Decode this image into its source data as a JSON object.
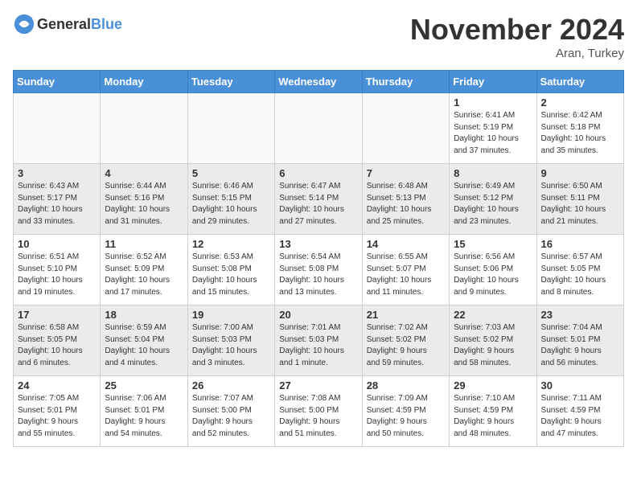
{
  "header": {
    "logo_general": "General",
    "logo_blue": "Blue",
    "month": "November 2024",
    "location": "Aran, Turkey"
  },
  "days_of_week": [
    "Sunday",
    "Monday",
    "Tuesday",
    "Wednesday",
    "Thursday",
    "Friday",
    "Saturday"
  ],
  "weeks": [
    [
      {
        "day": "",
        "info": ""
      },
      {
        "day": "",
        "info": ""
      },
      {
        "day": "",
        "info": ""
      },
      {
        "day": "",
        "info": ""
      },
      {
        "day": "",
        "info": ""
      },
      {
        "day": "1",
        "info": "Sunrise: 6:41 AM\nSunset: 5:19 PM\nDaylight: 10 hours\nand 37 minutes."
      },
      {
        "day": "2",
        "info": "Sunrise: 6:42 AM\nSunset: 5:18 PM\nDaylight: 10 hours\nand 35 minutes."
      }
    ],
    [
      {
        "day": "3",
        "info": "Sunrise: 6:43 AM\nSunset: 5:17 PM\nDaylight: 10 hours\nand 33 minutes."
      },
      {
        "day": "4",
        "info": "Sunrise: 6:44 AM\nSunset: 5:16 PM\nDaylight: 10 hours\nand 31 minutes."
      },
      {
        "day": "5",
        "info": "Sunrise: 6:46 AM\nSunset: 5:15 PM\nDaylight: 10 hours\nand 29 minutes."
      },
      {
        "day": "6",
        "info": "Sunrise: 6:47 AM\nSunset: 5:14 PM\nDaylight: 10 hours\nand 27 minutes."
      },
      {
        "day": "7",
        "info": "Sunrise: 6:48 AM\nSunset: 5:13 PM\nDaylight: 10 hours\nand 25 minutes."
      },
      {
        "day": "8",
        "info": "Sunrise: 6:49 AM\nSunset: 5:12 PM\nDaylight: 10 hours\nand 23 minutes."
      },
      {
        "day": "9",
        "info": "Sunrise: 6:50 AM\nSunset: 5:11 PM\nDaylight: 10 hours\nand 21 minutes."
      }
    ],
    [
      {
        "day": "10",
        "info": "Sunrise: 6:51 AM\nSunset: 5:10 PM\nDaylight: 10 hours\nand 19 minutes."
      },
      {
        "day": "11",
        "info": "Sunrise: 6:52 AM\nSunset: 5:09 PM\nDaylight: 10 hours\nand 17 minutes."
      },
      {
        "day": "12",
        "info": "Sunrise: 6:53 AM\nSunset: 5:08 PM\nDaylight: 10 hours\nand 15 minutes."
      },
      {
        "day": "13",
        "info": "Sunrise: 6:54 AM\nSunset: 5:08 PM\nDaylight: 10 hours\nand 13 minutes."
      },
      {
        "day": "14",
        "info": "Sunrise: 6:55 AM\nSunset: 5:07 PM\nDaylight: 10 hours\nand 11 minutes."
      },
      {
        "day": "15",
        "info": "Sunrise: 6:56 AM\nSunset: 5:06 PM\nDaylight: 10 hours\nand 9 minutes."
      },
      {
        "day": "16",
        "info": "Sunrise: 6:57 AM\nSunset: 5:05 PM\nDaylight: 10 hours\nand 8 minutes."
      }
    ],
    [
      {
        "day": "17",
        "info": "Sunrise: 6:58 AM\nSunset: 5:05 PM\nDaylight: 10 hours\nand 6 minutes."
      },
      {
        "day": "18",
        "info": "Sunrise: 6:59 AM\nSunset: 5:04 PM\nDaylight: 10 hours\nand 4 minutes."
      },
      {
        "day": "19",
        "info": "Sunrise: 7:00 AM\nSunset: 5:03 PM\nDaylight: 10 hours\nand 3 minutes."
      },
      {
        "day": "20",
        "info": "Sunrise: 7:01 AM\nSunset: 5:03 PM\nDaylight: 10 hours\nand 1 minute."
      },
      {
        "day": "21",
        "info": "Sunrise: 7:02 AM\nSunset: 5:02 PM\nDaylight: 9 hours\nand 59 minutes."
      },
      {
        "day": "22",
        "info": "Sunrise: 7:03 AM\nSunset: 5:02 PM\nDaylight: 9 hours\nand 58 minutes."
      },
      {
        "day": "23",
        "info": "Sunrise: 7:04 AM\nSunset: 5:01 PM\nDaylight: 9 hours\nand 56 minutes."
      }
    ],
    [
      {
        "day": "24",
        "info": "Sunrise: 7:05 AM\nSunset: 5:01 PM\nDaylight: 9 hours\nand 55 minutes."
      },
      {
        "day": "25",
        "info": "Sunrise: 7:06 AM\nSunset: 5:01 PM\nDaylight: 9 hours\nand 54 minutes."
      },
      {
        "day": "26",
        "info": "Sunrise: 7:07 AM\nSunset: 5:00 PM\nDaylight: 9 hours\nand 52 minutes."
      },
      {
        "day": "27",
        "info": "Sunrise: 7:08 AM\nSunset: 5:00 PM\nDaylight: 9 hours\nand 51 minutes."
      },
      {
        "day": "28",
        "info": "Sunrise: 7:09 AM\nSunset: 4:59 PM\nDaylight: 9 hours\nand 50 minutes."
      },
      {
        "day": "29",
        "info": "Sunrise: 7:10 AM\nSunset: 4:59 PM\nDaylight: 9 hours\nand 48 minutes."
      },
      {
        "day": "30",
        "info": "Sunrise: 7:11 AM\nSunset: 4:59 PM\nDaylight: 9 hours\nand 47 minutes."
      }
    ]
  ]
}
